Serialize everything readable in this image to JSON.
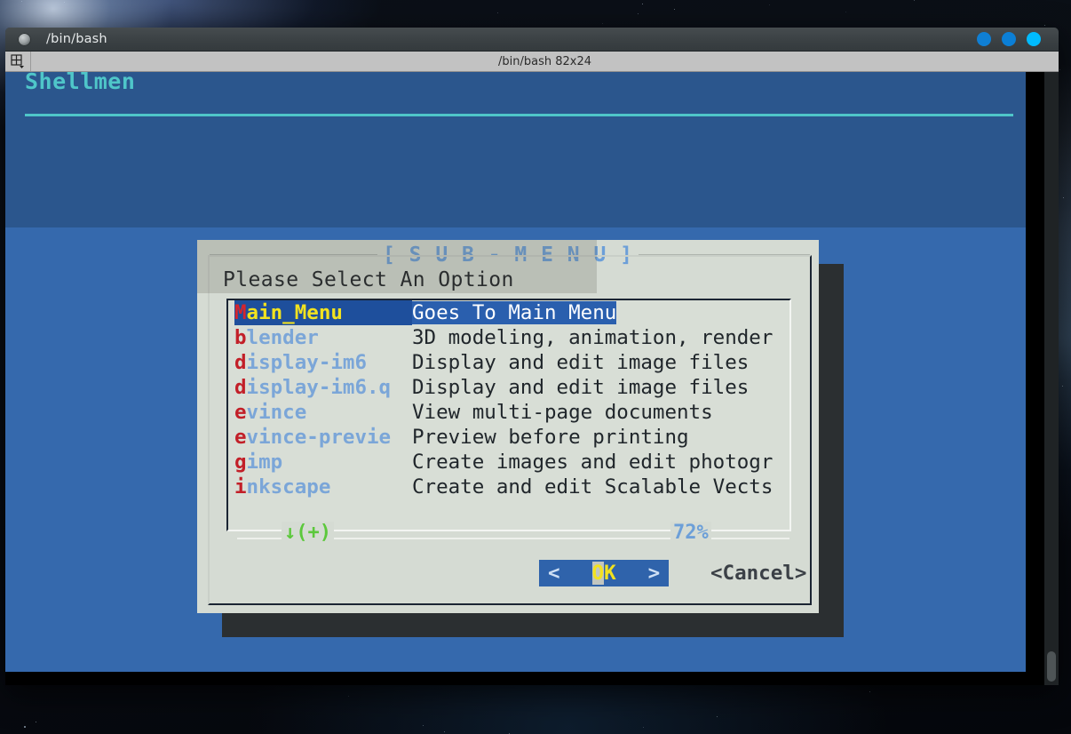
{
  "window": {
    "titlebar_title": "/bin/bash",
    "tab_label": "/bin/bash 82x24",
    "tab_icon": "grid-dropdown-icon",
    "buttons": [
      "minimize-dot",
      "maximize-dot",
      "close-dot"
    ],
    "button_colors": [
      "#0f7fd4",
      "#0b7fd6",
      "#00bbff"
    ]
  },
  "terminal": {
    "app_title": "Shellmen",
    "app_title_color": "#4fc6c9",
    "background_color": "#3569ad"
  },
  "dialog": {
    "title": "[ S U B - M E N U ]",
    "title_color": "#6c9fd8",
    "prompt": "Please Select An Option",
    "items": [
      {
        "first": "M",
        "rest": "ain_Menu",
        "desc": "Goes To Main Menu",
        "selected": true
      },
      {
        "first": "b",
        "rest": "lender",
        "desc": "3D modeling, animation, render",
        "selected": false
      },
      {
        "first": "d",
        "rest": "isplay-im6",
        "desc": "Display and edit image files",
        "selected": false
      },
      {
        "first": "d",
        "rest": "isplay-im6.q",
        "desc": "Display and edit image files",
        "selected": false
      },
      {
        "first": "e",
        "rest": "vince",
        "desc": "View multi-page documents",
        "selected": false
      },
      {
        "first": "e",
        "rest": "vince-previe",
        "desc": "Preview before printing",
        "selected": false
      },
      {
        "first": "g",
        "rest": "imp",
        "desc": "Create images and edit photogr",
        "selected": false
      },
      {
        "first": "i",
        "rest": "nkscape",
        "desc": "Create and edit Scalable Vects",
        "selected": false
      }
    ],
    "scroll": {
      "down_indicator": "↓(+)",
      "down_color": "#5cc83c",
      "percent": "72%",
      "percent_color": "#6c9fd8"
    },
    "buttons": {
      "ok_left_arrow": "<",
      "ok_label_first": "O",
      "ok_label_rest": "K",
      "ok_right_arrow": ">",
      "cancel_label": "<Cancel>"
    }
  }
}
